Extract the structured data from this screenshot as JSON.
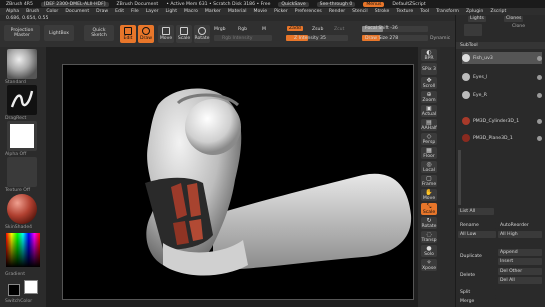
{
  "titlebar": {
    "app": "ZBrush 4R5",
    "doc_label": "[DEF 2300-DMEL-ALII-HDF]",
    "zbrush_doc": "ZBrush Document",
    "active_mem": "• Active Mem 631 • Scratch Disk 3186 • Free",
    "quicksave": "QuickSave",
    "see_through": "See-through 0",
    "menus": "Menus",
    "default_script": "DefaultZScript"
  },
  "menubar": [
    "Alpha",
    "Brush",
    "Color",
    "Document",
    "Draw",
    "Edit",
    "File",
    "Layer",
    "Light",
    "Macro",
    "Marker",
    "Material",
    "Movie",
    "Picker",
    "Preferences",
    "Render",
    "Stencil",
    "Stroke",
    "Texture",
    "Tool",
    "Transform",
    "Zplugin",
    "Zscript"
  ],
  "status": "0.686, 0.654, 0.55",
  "toolbar": {
    "projection_master": "Projection Master",
    "lightbox": "LightBox",
    "quick_sketch": "Quick Sketch",
    "edit": "Edit",
    "draw": "Draw",
    "move": "Move",
    "scale": "Scale",
    "rotate": "Rotate",
    "mrgb": "Mrgb",
    "rgb": "Rgb",
    "m": "M",
    "rgb_intensity": "Rgb Intensity",
    "zadd": "Zadd",
    "zsub": "Zsub",
    "zcut": "Zcut",
    "z_intensity": "Z Intensity 35",
    "focal_shift": "Focal Shift -36",
    "draw_size": "Draw Size 278",
    "dynamic": "Dynamic"
  },
  "left": {
    "brush_label": "Standard",
    "stroke_label": "DragRect",
    "alpha_label": "Alpha Off",
    "texture_label": "Texture Off",
    "material_label": "SkinShade4",
    "gradient": "Gradient",
    "switch_color": "SwitchColor"
  },
  "rightcol": [
    "BPR",
    "SPix 3",
    "Scroll",
    "Zoom",
    "Actual",
    "AAHalf",
    "Persp",
    "Floor",
    "Local",
    "Frame",
    "Move",
    "Scale",
    "Rotate",
    "Transp",
    "Solo",
    "Xpose"
  ],
  "panel": {
    "tab_lights": "Lights",
    "tab_clones": "Clones",
    "sublabel": "Clone",
    "subtool_header": "SubTool",
    "items": [
      "Fish_uv3",
      "Eyes_l",
      "Eye_R",
      "PM3D_Cylinder3D_1",
      "PM3D_Plane3D_1"
    ],
    "list_all": "List All",
    "rename": "Rename",
    "autoreorder": "AutoReorder",
    "all_low": "All Low",
    "all_high": "All High",
    "duplicate": "Duplicate",
    "append": "Append",
    "insert": "Insert",
    "delete": "Delete",
    "del_other": "Del Other",
    "del_all": "Del All",
    "split": "Split",
    "merge": "Merge"
  },
  "colors": {
    "accent": "#e8762a"
  }
}
